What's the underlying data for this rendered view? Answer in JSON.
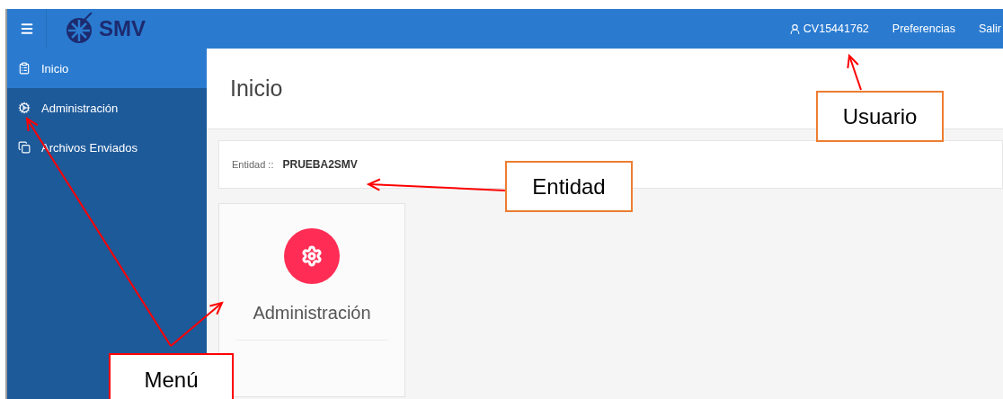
{
  "topbar": {
    "logo_text": "SMV",
    "user": "CV15441762",
    "links": [
      "Preferencias",
      "Salir"
    ]
  },
  "sidebar": {
    "items": [
      {
        "label": "Inicio",
        "selected": true
      },
      {
        "label": "Administración",
        "selected": false
      },
      {
        "label": "Archivos Enviados",
        "selected": false
      }
    ]
  },
  "page": {
    "title": "Inicio"
  },
  "entity": {
    "label": "Entidad ::",
    "value": "PRUEBA2SMV"
  },
  "tiles": [
    {
      "label": "Administración"
    }
  ],
  "annotations": [
    {
      "label": "Usuario",
      "color": "#ed7d31"
    },
    {
      "label": "Entidad",
      "color": "#ed7d31"
    },
    {
      "label": "Menú",
      "color": "#ff0000"
    }
  ]
}
